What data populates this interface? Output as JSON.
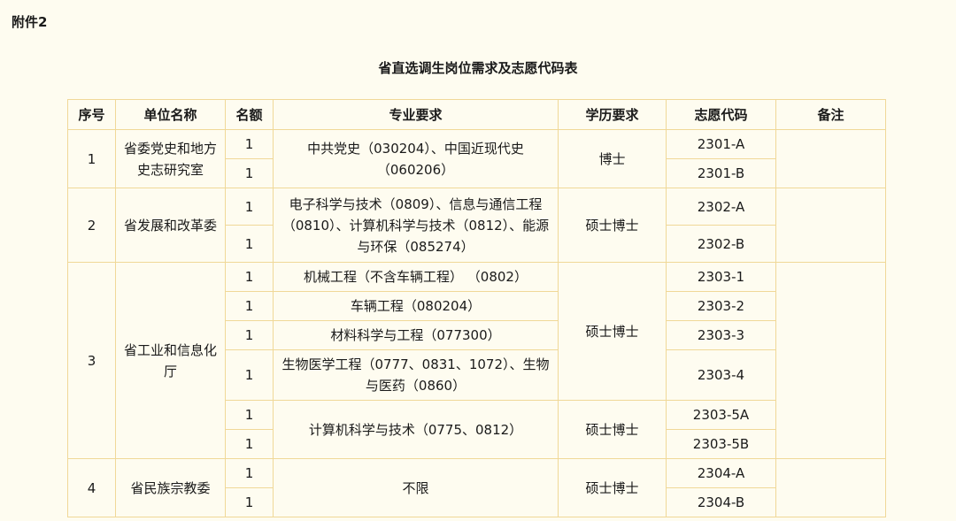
{
  "header": {
    "attachment_label": "附件2",
    "title": "省直选调生岗位需求及志愿代码表"
  },
  "table": {
    "columns": [
      "序号",
      "单位名称",
      "名额",
      "专业要求",
      "学历要求",
      "志愿代码",
      "备注"
    ],
    "rows": [
      {
        "seq": "1",
        "unit": "省委党史和地方史志研究室",
        "quota": "1",
        "major": "中共党史（030204）、中国近现代史（060206）",
        "edu": "博士",
        "code": "2301-A"
      },
      {
        "quota": "1",
        "code": "2301-B"
      },
      {
        "seq": "2",
        "unit": "省发展和改革委",
        "quota": "1",
        "major": "电子科学与技术（0809）、信息与通信工程（0810）、计算机科学与技术（0812）、能源与环保（085274）",
        "edu": "硕士博士",
        "code": "2302-A"
      },
      {
        "quota": "1",
        "code": "2302-B"
      },
      {
        "seq": "3",
        "unit": "省工业和信息化厅",
        "quota": "1",
        "major": "机械工程（不含车辆工程） （0802）",
        "edu": "硕士博士",
        "code": "2303-1"
      },
      {
        "quota": "1",
        "major": "车辆工程（080204）",
        "code": "2303-2"
      },
      {
        "quota": "1",
        "major": "材料科学与工程（077300）",
        "code": "2303-3"
      },
      {
        "quota": "1",
        "major": "生物医学工程（0777、0831、1072）、生物与医药（0860）",
        "code": "2303-4"
      },
      {
        "quota": "1",
        "major": "计算机科学与技术（0775、0812）",
        "edu": "硕士博士",
        "code": "2303-5A"
      },
      {
        "quota": "1",
        "code": "2303-5B"
      },
      {
        "seq": "4",
        "unit": "省民族宗教委",
        "quota": "1",
        "major": "不限",
        "edu": "硕士博士",
        "code": "2304-A"
      },
      {
        "quota": "1",
        "code": "2304-B"
      }
    ]
  }
}
